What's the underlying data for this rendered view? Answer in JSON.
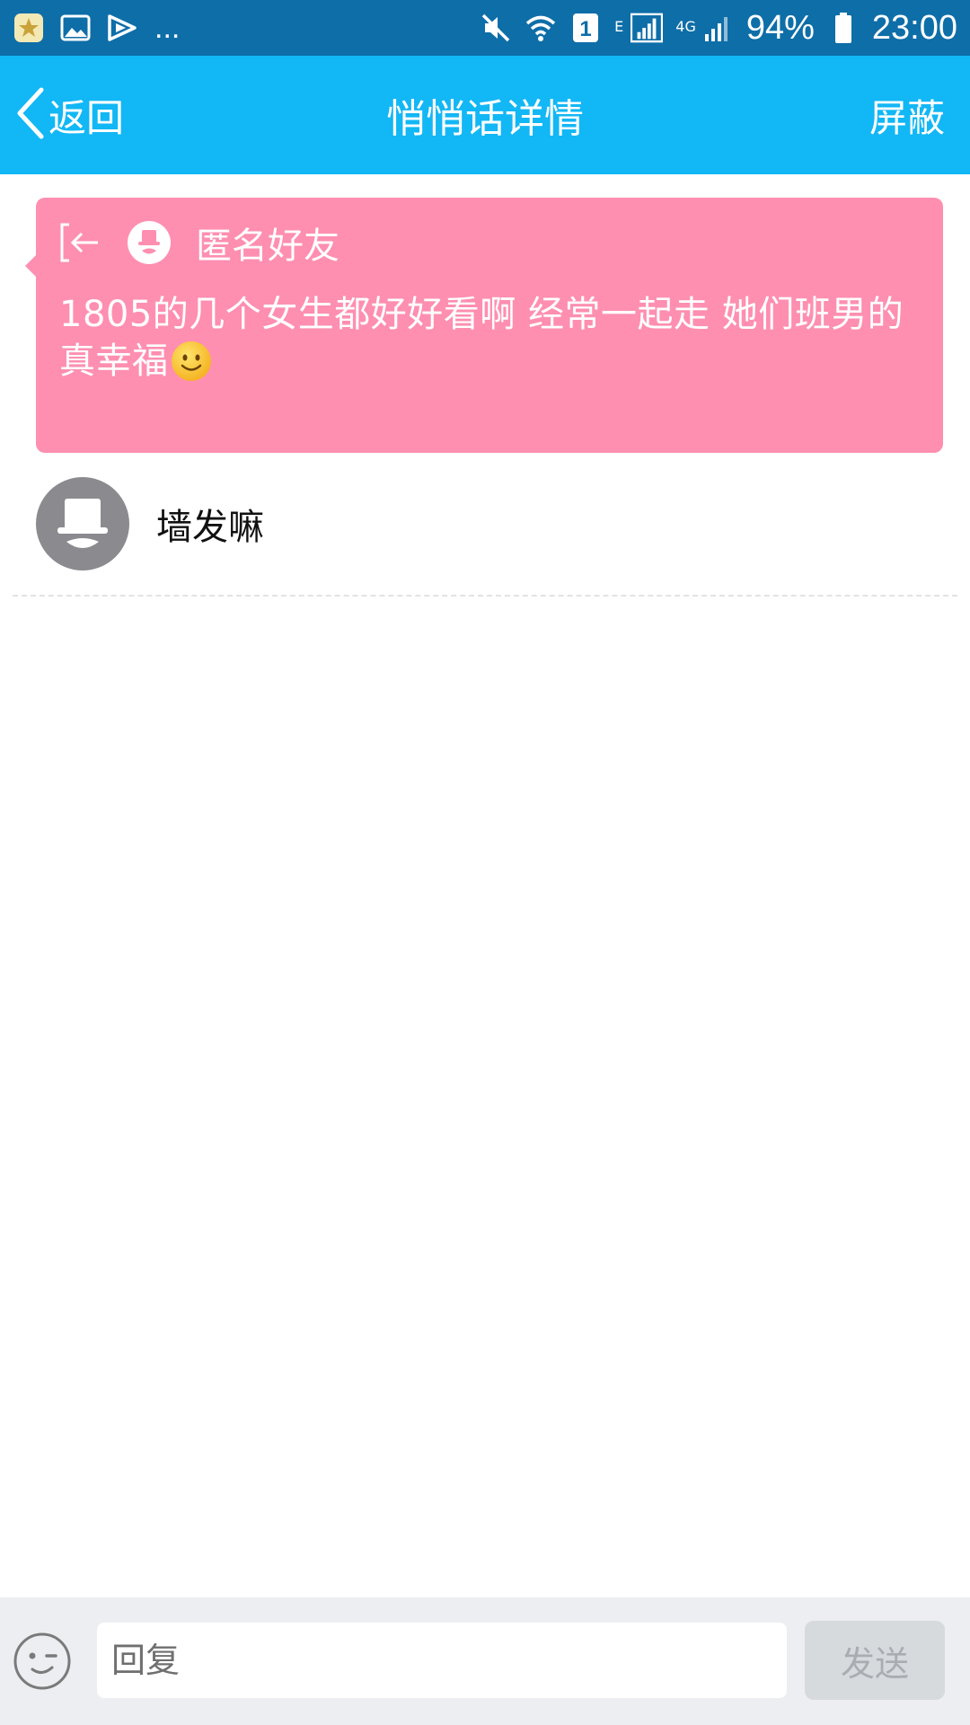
{
  "status_bar": {
    "notification_icons": [
      "app-icon",
      "gallery-icon",
      "video-icon"
    ],
    "overflow": "...",
    "network_e": "E",
    "network_4g": "4G",
    "sim": "1",
    "battery_percent": "94%",
    "time": "23:00"
  },
  "header": {
    "back_label": "返回",
    "title": "悄悄话详情",
    "block_label": "屏蔽",
    "bg_color": "#12b7f5"
  },
  "whisper": {
    "sender_name": "匿名好友",
    "message": "1805的几个女生都好好看啊 经常一起走 她们班男的真幸福",
    "emoji": "smile-emoji",
    "bg_color": "#fe8fb0"
  },
  "comment": {
    "author": "墙发嘛"
  },
  "input_bar": {
    "placeholder": "回复",
    "send_label": "发送"
  }
}
